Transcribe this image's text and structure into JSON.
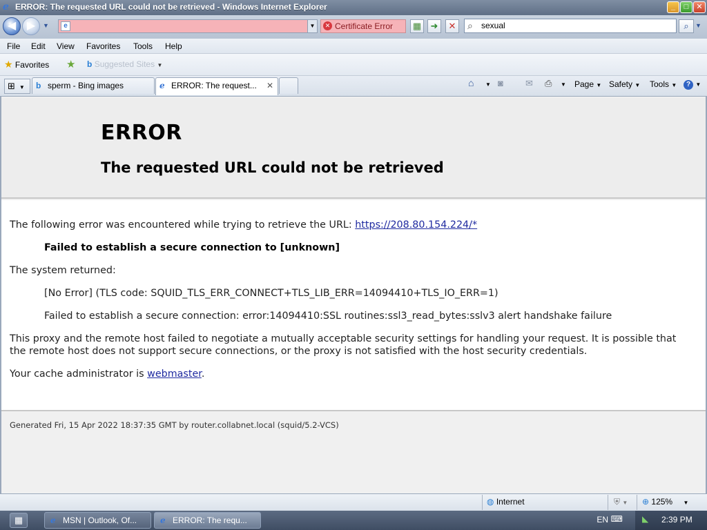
{
  "window": {
    "title": "ERROR: The requested URL could not be retrieved - Windows Internet Explorer",
    "minimize_glyph": "_",
    "maximize_glyph": "□",
    "close_glyph": "✕"
  },
  "addressbar": {
    "url": "",
    "certificate_label": "Certificate Error",
    "search_value": "sexual"
  },
  "menubar": {
    "items": [
      "File",
      "Edit",
      "View",
      "Favorites",
      "Tools",
      "Help"
    ]
  },
  "favorites_bar": {
    "favorites_label": "Favorites",
    "suggested_sites_label": "Suggested Sites"
  },
  "tabs": [
    {
      "label": "sperm - Bing images",
      "active": false
    },
    {
      "label": "ERROR: The request...",
      "active": true
    }
  ],
  "command_bar": {
    "page_label": "Page",
    "safety_label": "Safety",
    "tools_label": "Tools"
  },
  "page": {
    "heading": "ERROR",
    "subheading": "The requested URL could not be retrieved",
    "intro_text": "The following error was encountered while trying to retrieve the URL:",
    "url_link": "https://208.80.154.224/*",
    "failed_text": "Failed to establish a secure connection to [unknown]",
    "system_returned": "The system returned:",
    "tls_code": "[No Error] (TLS code: SQUID_TLS_ERR_CONNECT+TLS_LIB_ERR=14094410+TLS_IO_ERR=1)",
    "ssl_error": "Failed to establish a secure connection: error:14094410:SSL routines:ssl3_read_bytes:sslv3 alert handshake failure",
    "explanation_line1": "This proxy and the remote host failed to negotiate a mutually acceptable security settings for handling your request. It is possible that",
    "explanation_line2": "the remote host does not support secure connections, or the proxy is not satisfied with the host security credentials.",
    "admin_prefix": "Your cache administrator is",
    "admin_link": "webmaster",
    "admin_suffix": ".",
    "footer": "Generated Fri, 15 Apr 2022 18:37:35 GMT by router.collabnet.local (squid/5.2-VCS)"
  },
  "statusbar": {
    "zone": "Internet",
    "zoom": "125%"
  },
  "taskbar": {
    "buttons": [
      {
        "label": "MSN | Outlook, Of...",
        "active": false
      },
      {
        "label": "ERROR: The requ...",
        "active": true
      }
    ],
    "language": "EN",
    "clock": "2:39 PM"
  },
  "colors": {
    "address_error_bg": "#f6b3b8",
    "link": "#1f2aa0",
    "titlebar": "#6f7f93"
  }
}
